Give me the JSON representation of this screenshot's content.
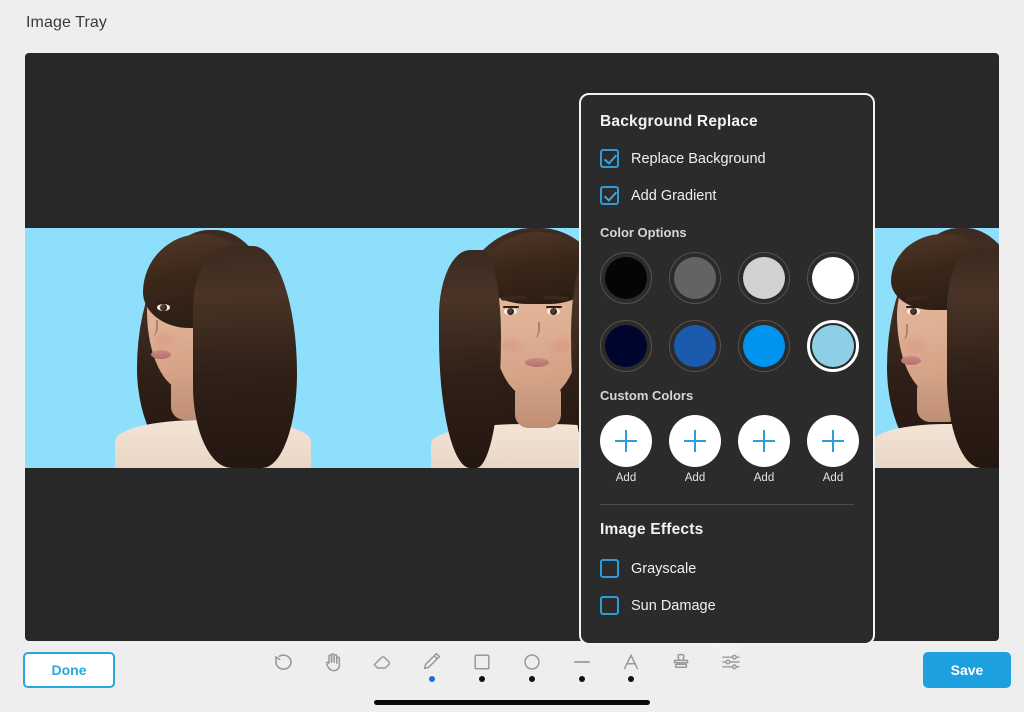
{
  "header": {
    "title": "Image Tray"
  },
  "canvas": {
    "background_color": "#282828",
    "photo_background_color": "#8edffc",
    "alt": "Two portraits of a woman on a light blue background"
  },
  "panel": {
    "title": "Background Replace",
    "checkboxes": [
      {
        "label": "Replace Background",
        "checked": true
      },
      {
        "label": "Add Gradient",
        "checked": true
      }
    ],
    "color_options_label": "Color Options",
    "color_options": [
      {
        "name": "black",
        "hex": "#050505",
        "selected": false
      },
      {
        "name": "gray",
        "hex": "#636363",
        "selected": false
      },
      {
        "name": "light-gray",
        "hex": "#d2d2d2",
        "selected": false
      },
      {
        "name": "white",
        "hex": "#ffffff",
        "selected": false
      },
      {
        "name": "navy",
        "hex": "#00062e",
        "selected": false
      },
      {
        "name": "medium-blue",
        "hex": "#1a5bad",
        "selected": false
      },
      {
        "name": "bright-blue",
        "hex": "#0094ef",
        "selected": false
      },
      {
        "name": "light-blue",
        "hex": "#8ecfe8",
        "selected": true
      }
    ],
    "custom_colors_label": "Custom Colors",
    "custom_colors": [
      {
        "label": "Add"
      },
      {
        "label": "Add"
      },
      {
        "label": "Add"
      },
      {
        "label": "Add"
      }
    ],
    "image_effects_label": "Image Effects",
    "effects": [
      {
        "label": "Grayscale",
        "checked": false
      },
      {
        "label": "Sun Damage",
        "checked": false
      }
    ],
    "accent_color": "#2e9bdb"
  },
  "bottom_bar": {
    "done_label": "Done",
    "save_label": "Save",
    "done_accent": "#29a7e0",
    "save_background": "#1ca0e0",
    "tools": [
      {
        "name": "undo-icon",
        "has_dot": false,
        "active": false
      },
      {
        "name": "hand-icon",
        "has_dot": false,
        "active": false
      },
      {
        "name": "eraser-icon",
        "has_dot": false,
        "active": false
      },
      {
        "name": "pencil-icon",
        "has_dot": true,
        "active": true
      },
      {
        "name": "square-icon",
        "has_dot": true,
        "active": false
      },
      {
        "name": "circle-icon",
        "has_dot": true,
        "active": false
      },
      {
        "name": "line-icon",
        "has_dot": true,
        "active": false
      },
      {
        "name": "text-icon",
        "has_dot": true,
        "active": false
      },
      {
        "name": "stamp-icon",
        "has_dot": false,
        "active": false
      },
      {
        "name": "settings-sliders-icon",
        "has_dot": false,
        "active": false
      }
    ]
  }
}
